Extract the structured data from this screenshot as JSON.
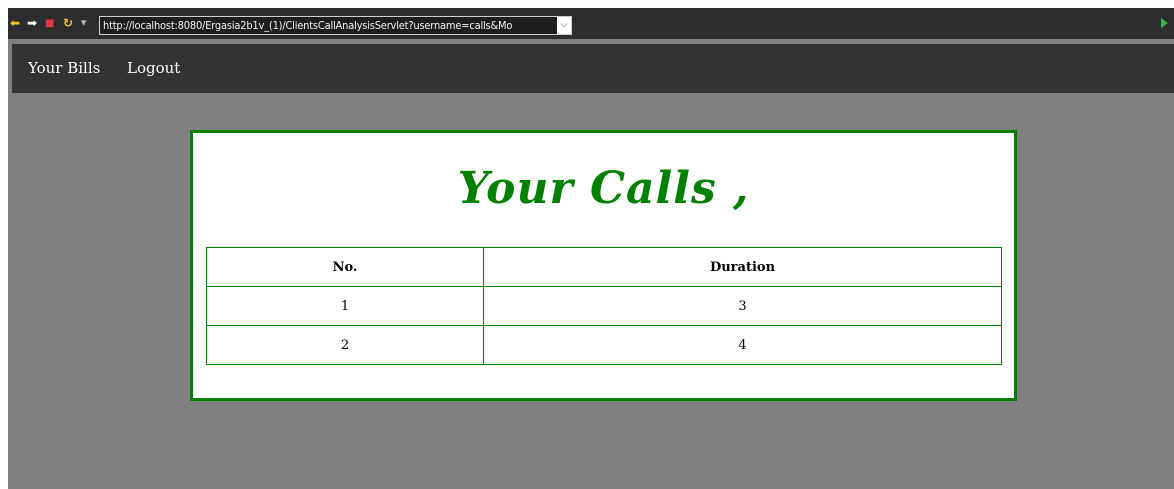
{
  "browser": {
    "url": "http://localhost:8080/Ergasia2b1v_(1)/ClientsCallAnalysisServlet?username=calls&Mo",
    "icons": {
      "back": "back-arrow-icon",
      "forward": "forward-arrow-icon",
      "stop": "stop-icon",
      "refresh": "refresh-icon",
      "menu": "chevron-down-icon",
      "url_dropdown": "chevron-down-icon",
      "go": "go-play-icon"
    },
    "colors": {
      "back": "#f4c531",
      "forward": "#ffffff",
      "stop": "#e8353b",
      "refresh": "#f4c531",
      "go": "#3bb54a"
    },
    "glyphs": {
      "back": "⬅",
      "forward": "➡",
      "stop": "■",
      "refresh": "↻",
      "menu": "▾",
      "url_dropdown": "⌵"
    }
  },
  "nav": {
    "items": [
      {
        "label": "Your Bills"
      },
      {
        "label": "Logout"
      }
    ]
  },
  "main": {
    "heading": "Your Calls ,",
    "accent_color": "#008000",
    "table": {
      "columns": [
        "No.",
        "Duration"
      ],
      "rows": [
        [
          "1",
          "3"
        ],
        [
          "2",
          "4"
        ]
      ]
    }
  }
}
